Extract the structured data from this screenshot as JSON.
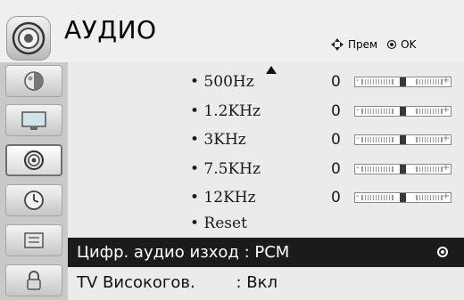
{
  "header": {
    "title": "АУДИО",
    "icon": "speaker-icon",
    "hint_move": "Прем",
    "hint_ok": "OK"
  },
  "sidebar": {
    "items": [
      {
        "icon": "picture-icon",
        "active": false
      },
      {
        "icon": "screen-icon",
        "active": false
      },
      {
        "icon": "audio-icon",
        "active": true
      },
      {
        "icon": "time-icon",
        "active": false
      },
      {
        "icon": "options-icon",
        "active": false
      },
      {
        "icon": "lock-icon",
        "active": false
      }
    ]
  },
  "equalizer": {
    "bands": [
      {
        "label": "• 500Hz",
        "value": "0",
        "level": 0.5
      },
      {
        "label": "• 1.2KHz",
        "value": "0",
        "level": 0.5
      },
      {
        "label": "• 3KHz",
        "value": "0",
        "level": 0.5
      },
      {
        "label": "• 7.5KHz",
        "value": "0",
        "level": 0.5
      },
      {
        "label": "• 12KHz",
        "value": "0",
        "level": 0.5
      }
    ],
    "reset_label": "• Reset"
  },
  "options": [
    {
      "label": "Цифр. аудио изход : PCM",
      "selected": true
    },
    {
      "label": "TV Високогов.        : Вкл",
      "selected": false
    }
  ],
  "colors": {
    "selected_bg": "#1b1b1b",
    "background": "#ebebeb",
    "sidebar": "#c9c9c9"
  }
}
